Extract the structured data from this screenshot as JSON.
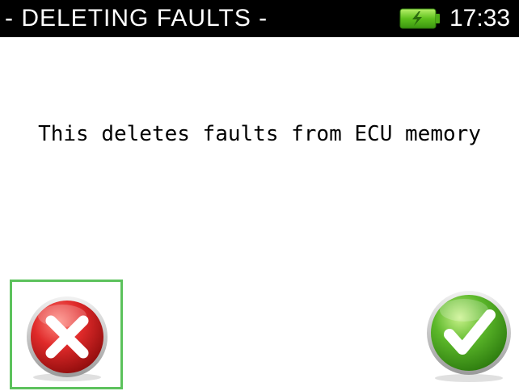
{
  "header": {
    "title": "- DELETING FAULTS -",
    "time": "17:33",
    "battery_icon": "battery-charging-icon"
  },
  "dialog": {
    "message": "This deletes faults from ECU memory"
  },
  "actions": {
    "cancel_icon": "cancel-x-icon",
    "confirm_icon": "confirm-check-icon"
  },
  "colors": {
    "title_bar": "#000000",
    "title_text": "#ffffff",
    "selection_border": "#5cc25c",
    "cancel_red": "#d41f1f",
    "confirm_green": "#4caf2a"
  }
}
